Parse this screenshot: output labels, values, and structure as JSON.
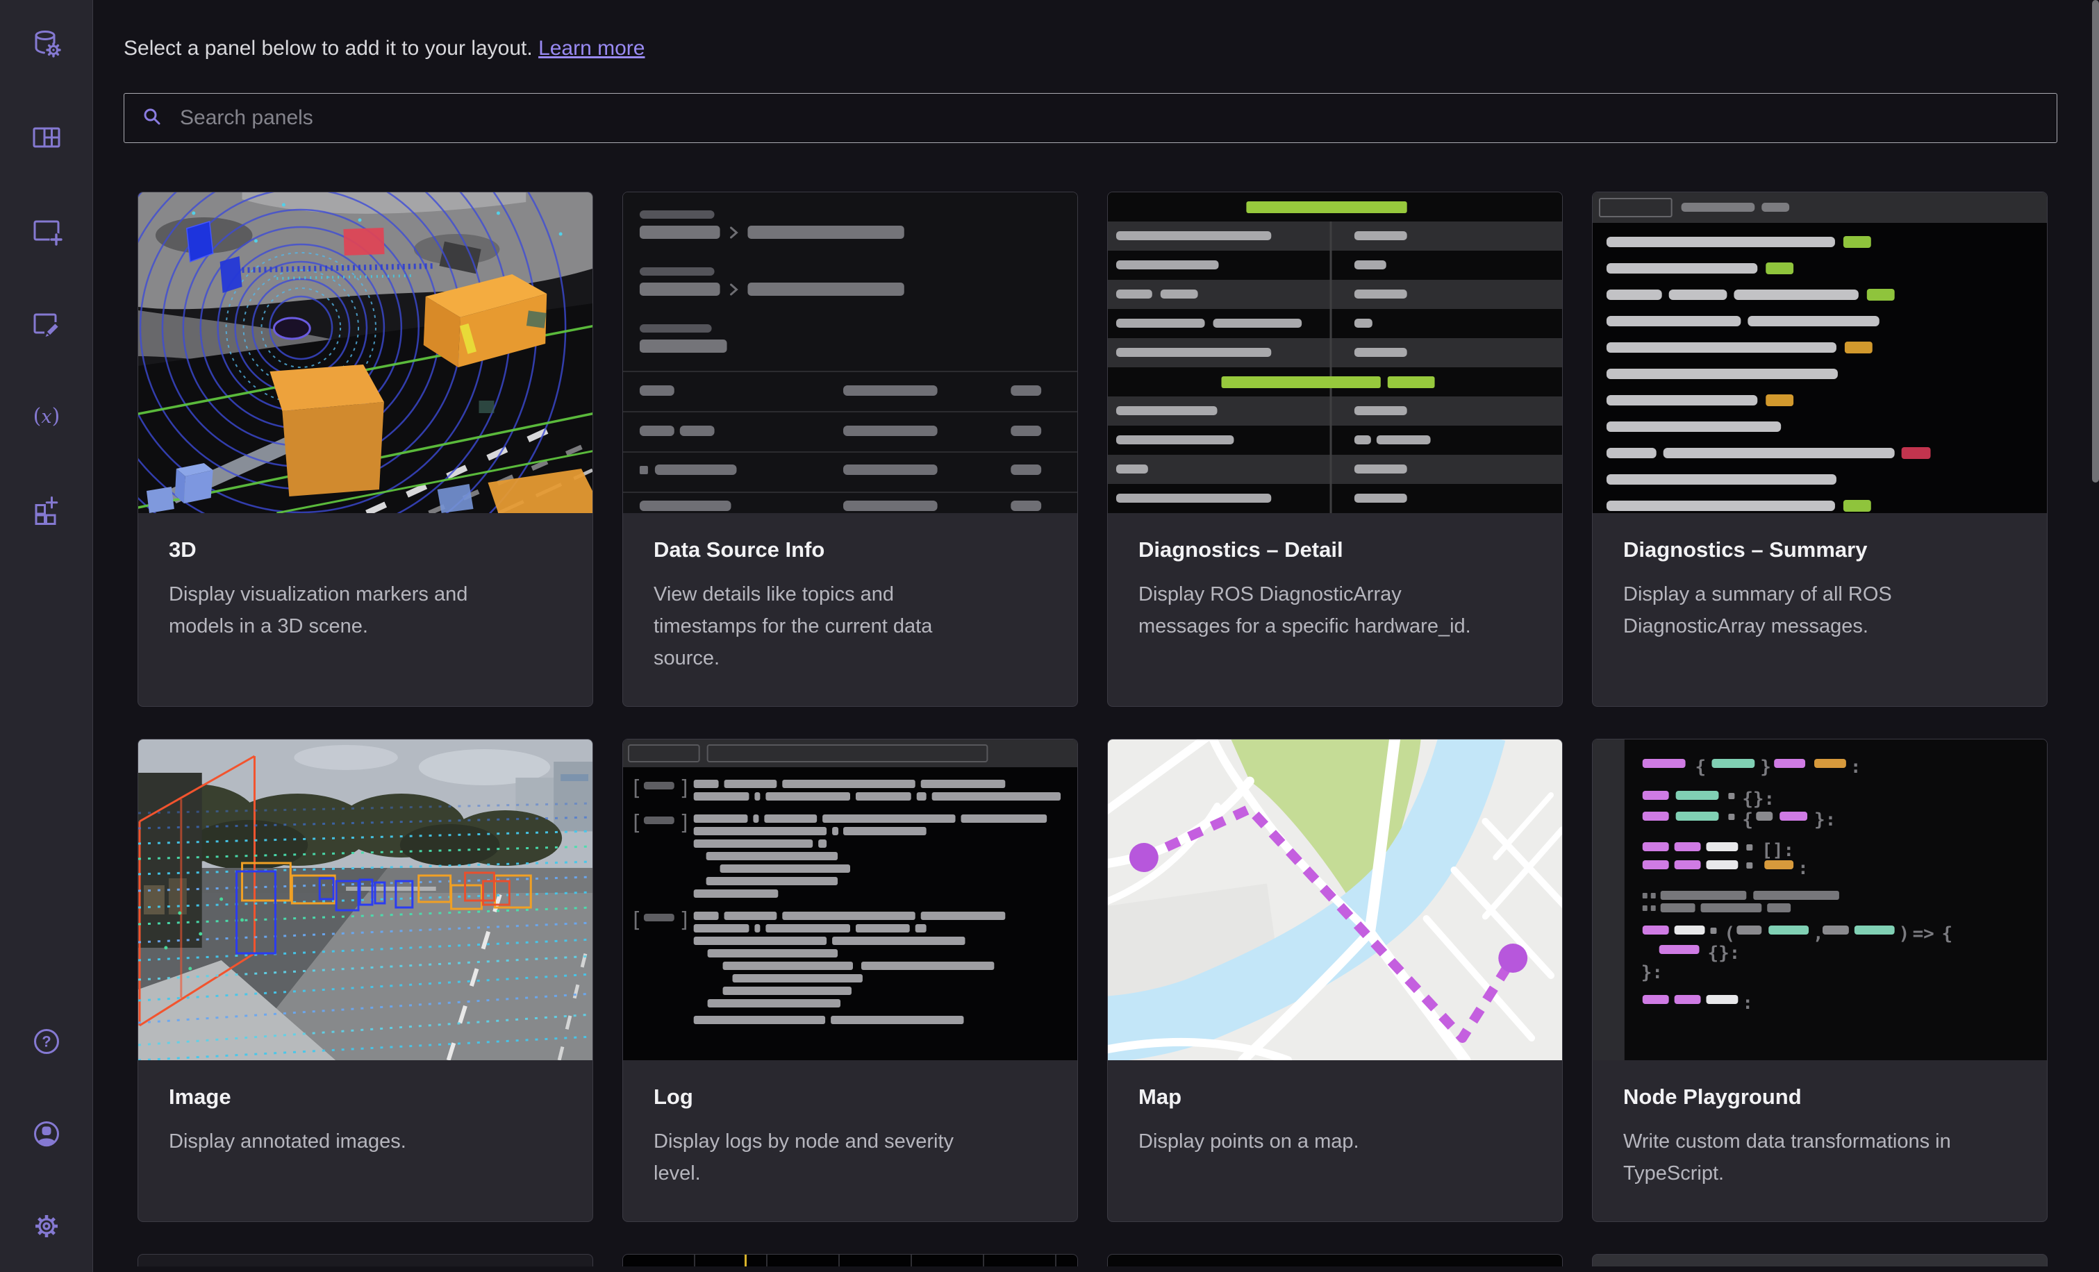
{
  "header": {
    "prompt": "Select a panel below to add it to your layout.",
    "learn_more": "Learn more"
  },
  "search": {
    "placeholder": "Search panels"
  },
  "sidebar": {
    "top_icons": [
      "data-source-settings",
      "layout-grid",
      "add-panel",
      "edit-layout",
      "variables",
      "extensions"
    ],
    "bottom_icons": [
      "help",
      "account",
      "settings"
    ]
  },
  "panels": [
    {
      "title": "3D",
      "description": "Display visualization markers and\nmodels in a 3D scene."
    },
    {
      "title": "Data Source Info",
      "description": "View details like topics and\ntimestamps for the current data\nsource."
    },
    {
      "title": "Diagnostics – Detail",
      "description": "Display ROS DiagnosticArray\nmessages for a specific hardware_id."
    },
    {
      "title": "Diagnostics – Summary",
      "description": "Display a summary of all ROS\nDiagnosticArray messages."
    },
    {
      "title": "Image",
      "description": "Display annotated images."
    },
    {
      "title": "Log",
      "description": "Display logs by node and severity\nlevel."
    },
    {
      "title": "Map",
      "description": "Display points on a map."
    },
    {
      "title": "Node Playground",
      "description": "Write custom data transformations in\nTypeScript."
    }
  ],
  "partial_cards_visible": 4,
  "colors": {
    "accent_purple": "#8579d2",
    "link_purple": "#998af2",
    "badge_green": "#8fc43c",
    "badge_orange": "#d2992d",
    "badge_red": "#c2344e",
    "map_path_purple": "#c45fdf"
  }
}
